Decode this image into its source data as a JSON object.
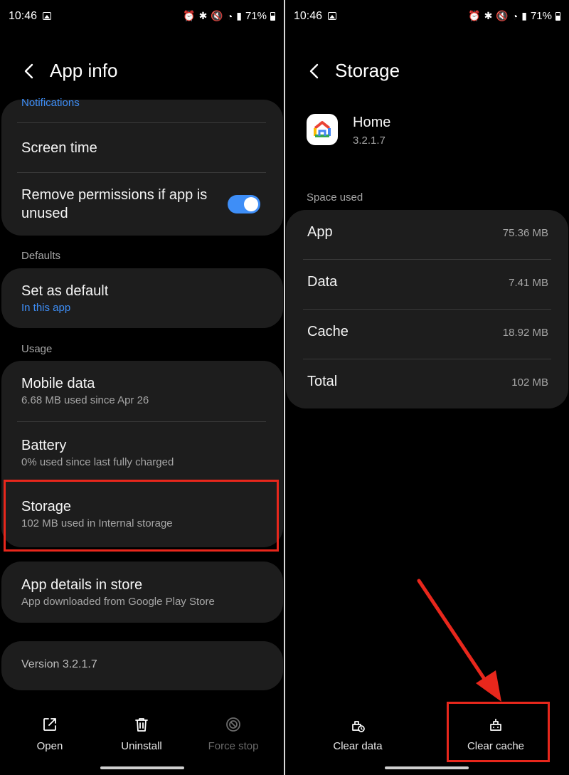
{
  "left": {
    "status": {
      "time": "10:46",
      "battery_pct": "71%"
    },
    "header": {
      "title": "App info"
    },
    "notifications_label": "Notifications",
    "screen_time": "Screen time",
    "remove_permissions": {
      "label": "Remove permissions if app is unused",
      "enabled": true
    },
    "defaults_label": "Defaults",
    "set_as_default": {
      "title": "Set as default",
      "subtitle": "In this app"
    },
    "usage_label": "Usage",
    "mobile_data": {
      "title": "Mobile data",
      "subtitle": "6.68 MB used since Apr 26"
    },
    "battery": {
      "title": "Battery",
      "subtitle": "0% used since last fully charged"
    },
    "storage": {
      "title": "Storage",
      "subtitle": "102 MB used in Internal storage"
    },
    "app_details": {
      "title": "App details in store",
      "subtitle": "App downloaded from Google Play Store"
    },
    "version": "Version 3.2.1.7",
    "actions": {
      "open": "Open",
      "uninstall": "Uninstall",
      "force_stop": "Force stop"
    }
  },
  "right": {
    "status": {
      "time": "10:46",
      "battery_pct": "71%"
    },
    "header": {
      "title": "Storage"
    },
    "app": {
      "name": "Home",
      "version": "3.2.1.7"
    },
    "space_used_label": "Space used",
    "rows": [
      {
        "label": "App",
        "value": "75.36 MB"
      },
      {
        "label": "Data",
        "value": "7.41 MB"
      },
      {
        "label": "Cache",
        "value": "18.92 MB"
      },
      {
        "label": "Total",
        "value": "102 MB"
      }
    ],
    "actions": {
      "clear_data": "Clear data",
      "clear_cache": "Clear cache"
    }
  },
  "colors": {
    "accent": "#3e8ef7",
    "highlight": "#e8271c",
    "card": "#1d1d1d",
    "background": "#000000"
  }
}
